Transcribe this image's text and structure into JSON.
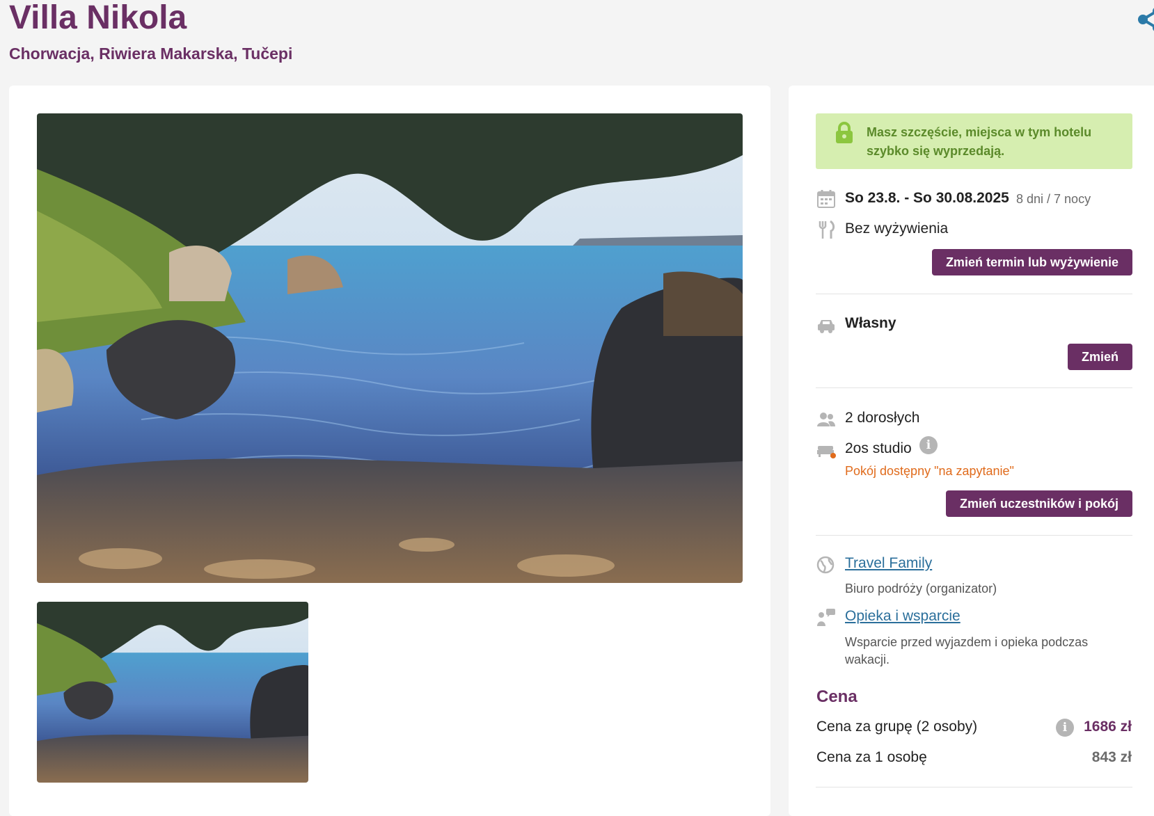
{
  "header": {
    "title": "Villa Nikola",
    "subtitle": "Chorwacja, Riwiera Makarska, Tučepi"
  },
  "alert": {
    "text": "Masz szczęście, miejsca w tym hotelu szybko się wyprzedają."
  },
  "trip": {
    "dates": "So 23.8. - So 30.08.2025",
    "duration": "8 dni / 7 nocy",
    "board": "Bez wyżywienia",
    "change_term_button": "Zmień termin lub wyżywienie"
  },
  "transport": {
    "label": "Własny",
    "change_button": "Zmień"
  },
  "participants": {
    "adults": "2 dorosłych",
    "room": "2os studio",
    "room_status": "Pokój dostępny \"na zapytanie\"",
    "change_button": "Zmień uczestników i pokój"
  },
  "organizer": {
    "name": "Travel Family",
    "description": "Biuro podróży (organizator)"
  },
  "support": {
    "name": "Opieka i wsparcie",
    "description": "Wsparcie przed wyjazdem i opieka podczas wakacji."
  },
  "price": {
    "heading": "Cena",
    "group_label": "Cena za grupę (2 osoby)",
    "group_value": "1686 zł",
    "person_label": "Cena za 1 osobę",
    "person_value": "843 zł"
  },
  "icons": {
    "share": "share-icon",
    "lock": "lock-icon",
    "calendar": "calendar-icon",
    "board": "fork-knife-icon",
    "car": "car-icon",
    "people": "people-icon",
    "bed": "bed-icon",
    "globe": "globe-icon",
    "support": "support-icon",
    "info": "info-icon"
  },
  "colors": {
    "brand": "#6a2f64",
    "alert_bg": "#d6eeb0",
    "alert_text": "#5b8a2a",
    "warning": "#e06b1c",
    "link": "#2b6f9b",
    "share": "#2b7aa8"
  }
}
